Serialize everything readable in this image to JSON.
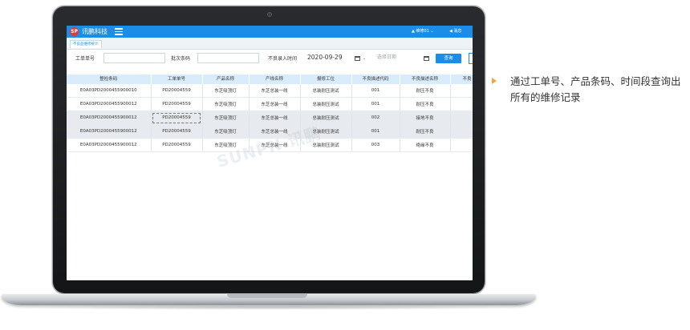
{
  "app": {
    "logo_text": "SP",
    "name": "讯鹏科技",
    "user_label": "▲ 维修01 ⌄",
    "messages_label": "◀ 消息"
  },
  "tab": {
    "label": "不良品维修统计"
  },
  "filters": {
    "work_order_label": "工单单号",
    "work_order_value": "",
    "batch_label": "批次条码",
    "batch_value": "",
    "date_label": "不良录入时间",
    "start_date": "2020-09-29",
    "separator": "-",
    "end_date_placeholder": "选择日期",
    "query_button": "查询"
  },
  "table": {
    "columns": [
      "整检条码",
      "工单单号",
      "产品名称",
      "产线名称",
      "报修工位",
      "不良描述代码",
      "不良描述名称",
      "不良"
    ],
    "rows": [
      [
        "E0A03PD2000455900010",
        "PD20004559",
        "东芝吸顶灯",
        "东芝总装一线",
        "总装耐压测试",
        "001",
        "耐压不良"
      ],
      [
        "E0A03PD2000455900012",
        "PD20004559",
        "东芝吸顶灯",
        "东芝总装一线",
        "总装耐压测试",
        "001",
        "耐压不良"
      ],
      [
        "E0A03PD2000455900012",
        "PD20004559",
        "东芝吸顶灯",
        "东芝总装一线",
        "总装耐压测试",
        "002",
        "接地不良"
      ],
      [
        "E0A03PD2000455900012",
        "PD20004559",
        "东芝吸顶灯",
        "东芝总装一线",
        "总装耐压测试",
        "001",
        "耐压不良"
      ],
      [
        "E0A03PD2000455900012",
        "PD20004559",
        "东芝吸顶灯",
        "东芝总装一线",
        "总装耐压测试",
        "003",
        "绝缘不良"
      ]
    ]
  },
  "watermark": "SUNPN 讯鹏",
  "note": {
    "text": "通过工单号、产品条码、时间段查询出所有的维修记录"
  },
  "colors": {
    "primary": "#1b8de6",
    "header_bg": "#d9ecfb",
    "arrow": "#f2a33a"
  }
}
